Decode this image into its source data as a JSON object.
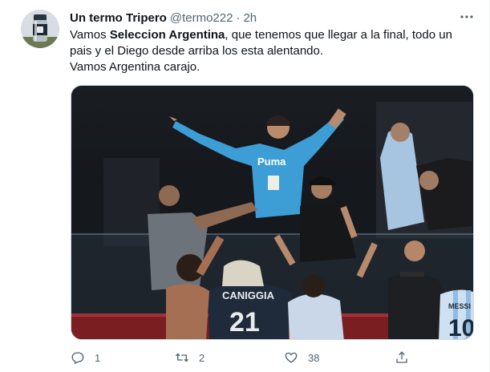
{
  "tweet": {
    "display_name": "Un termo Tripero",
    "handle": "@termo222",
    "separator": "·",
    "time": "2h",
    "text_line1_a": "Vamos ",
    "text_line1_bold": "Seleccion Argentina",
    "text_line1_b": ", que tenemos que llegar a la final, todo un",
    "text_line2": "pais y el Diego desde arriba los esta alentando.",
    "text_line3": "Vamos Argentina carajo.",
    "replies": "1",
    "retweets": "2",
    "likes": "38"
  },
  "media": {
    "shirt_text": "Puma",
    "jersey_name": "CANIGGIA",
    "jersey_number": "21",
    "jersey2_name": "MESSI",
    "jersey2_number": "10"
  },
  "icons": [
    "more-icon",
    "reply-icon",
    "retweet-icon",
    "like-icon",
    "share-icon"
  ],
  "colors": {
    "text": "#0f1419",
    "secondary": "#536471",
    "border": "#cfd9de"
  }
}
